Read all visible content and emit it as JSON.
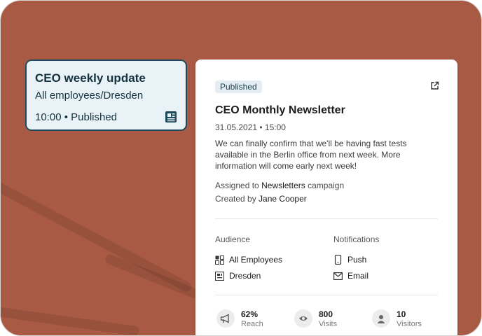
{
  "mini_card": {
    "title": "CEO weekly update",
    "subtitle": "All employees/Dresden",
    "meta": "10:00 • Published",
    "icon": "newspaper-icon"
  },
  "detail": {
    "badge": "Published",
    "title": "CEO Monthly Newsletter",
    "date": "31.05.2021 • 15:00",
    "body": "We can finally confirm that we'll be having fast tests available in the Berlin office from next week. More information will come early next week!",
    "assigned_prefix": "Assigned to",
    "assigned_campaign": "Newsletters",
    "assigned_suffix": "campaign",
    "created_prefix": "Created by",
    "created_by": "Jane Cooper",
    "audience_label": "Audience",
    "audience": [
      {
        "label": "All Employees",
        "icon": "grid-icon"
      },
      {
        "label": "Dresden",
        "icon": "building-icon"
      }
    ],
    "notifications_label": "Notifications",
    "notifications": [
      {
        "label": "Push",
        "icon": "phone-icon"
      },
      {
        "label": "Email",
        "icon": "mail-icon"
      }
    ],
    "stats": [
      {
        "value": "62%",
        "label": "Reach",
        "icon": "megaphone-icon"
      },
      {
        "value": "800",
        "label": "Visits",
        "icon": "eye-icon"
      },
      {
        "value": "10",
        "label": "Visitors",
        "icon": "person-icon"
      }
    ]
  },
  "colors": {
    "background": "#a85a44",
    "mini_card_bg": "#e9f2f7",
    "mini_card_border": "#1d4a5c",
    "badge_bg": "#e3edf3"
  }
}
